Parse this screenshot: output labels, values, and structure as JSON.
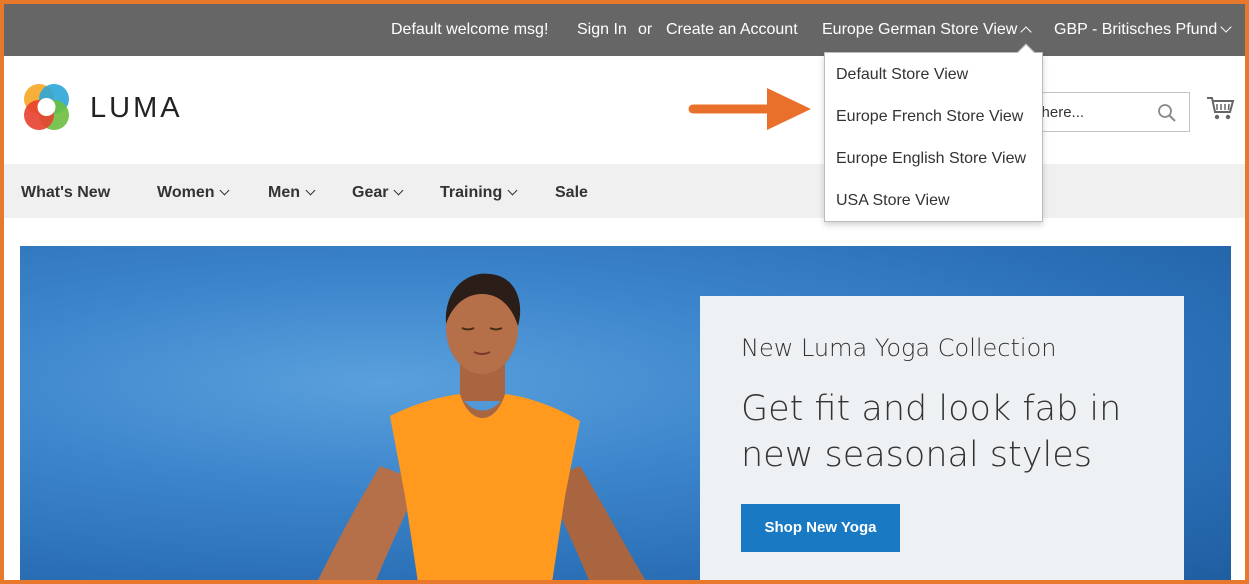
{
  "topbar": {
    "welcome": "Default welcome msg!",
    "sign_in": "Sign In",
    "or": "or",
    "create_account": "Create an Account",
    "store_switcher": "Europe German Store View",
    "currency": "GBP - Britisches Pfund"
  },
  "header": {
    "logo_text": "LUMA",
    "search_value": "e here...",
    "icons": [
      "luma-logo-icon",
      "search-icon",
      "cart-icon",
      "arrow-icon"
    ]
  },
  "store_dropdown": {
    "items": [
      "Default Store View",
      "Europe French Store View",
      "Europe English Store View",
      "USA Store View"
    ]
  },
  "nav": {
    "items": [
      {
        "label": "What's New"
      },
      {
        "label": "Women"
      },
      {
        "label": "Men"
      },
      {
        "label": "Gear"
      },
      {
        "label": "Training"
      },
      {
        "label": "Sale"
      }
    ]
  },
  "hero": {
    "subtitle": "New Luma Yoga Collection",
    "title": "Get fit and look fab in new seasonal styles",
    "button": "Shop New Yoga"
  },
  "colors": {
    "frame_border": "#e8782b",
    "topbar_bg": "#666666",
    "nav_bg": "#f0f0f0",
    "button_blue": "#1979c3",
    "arrow_orange": "#e8702a"
  }
}
